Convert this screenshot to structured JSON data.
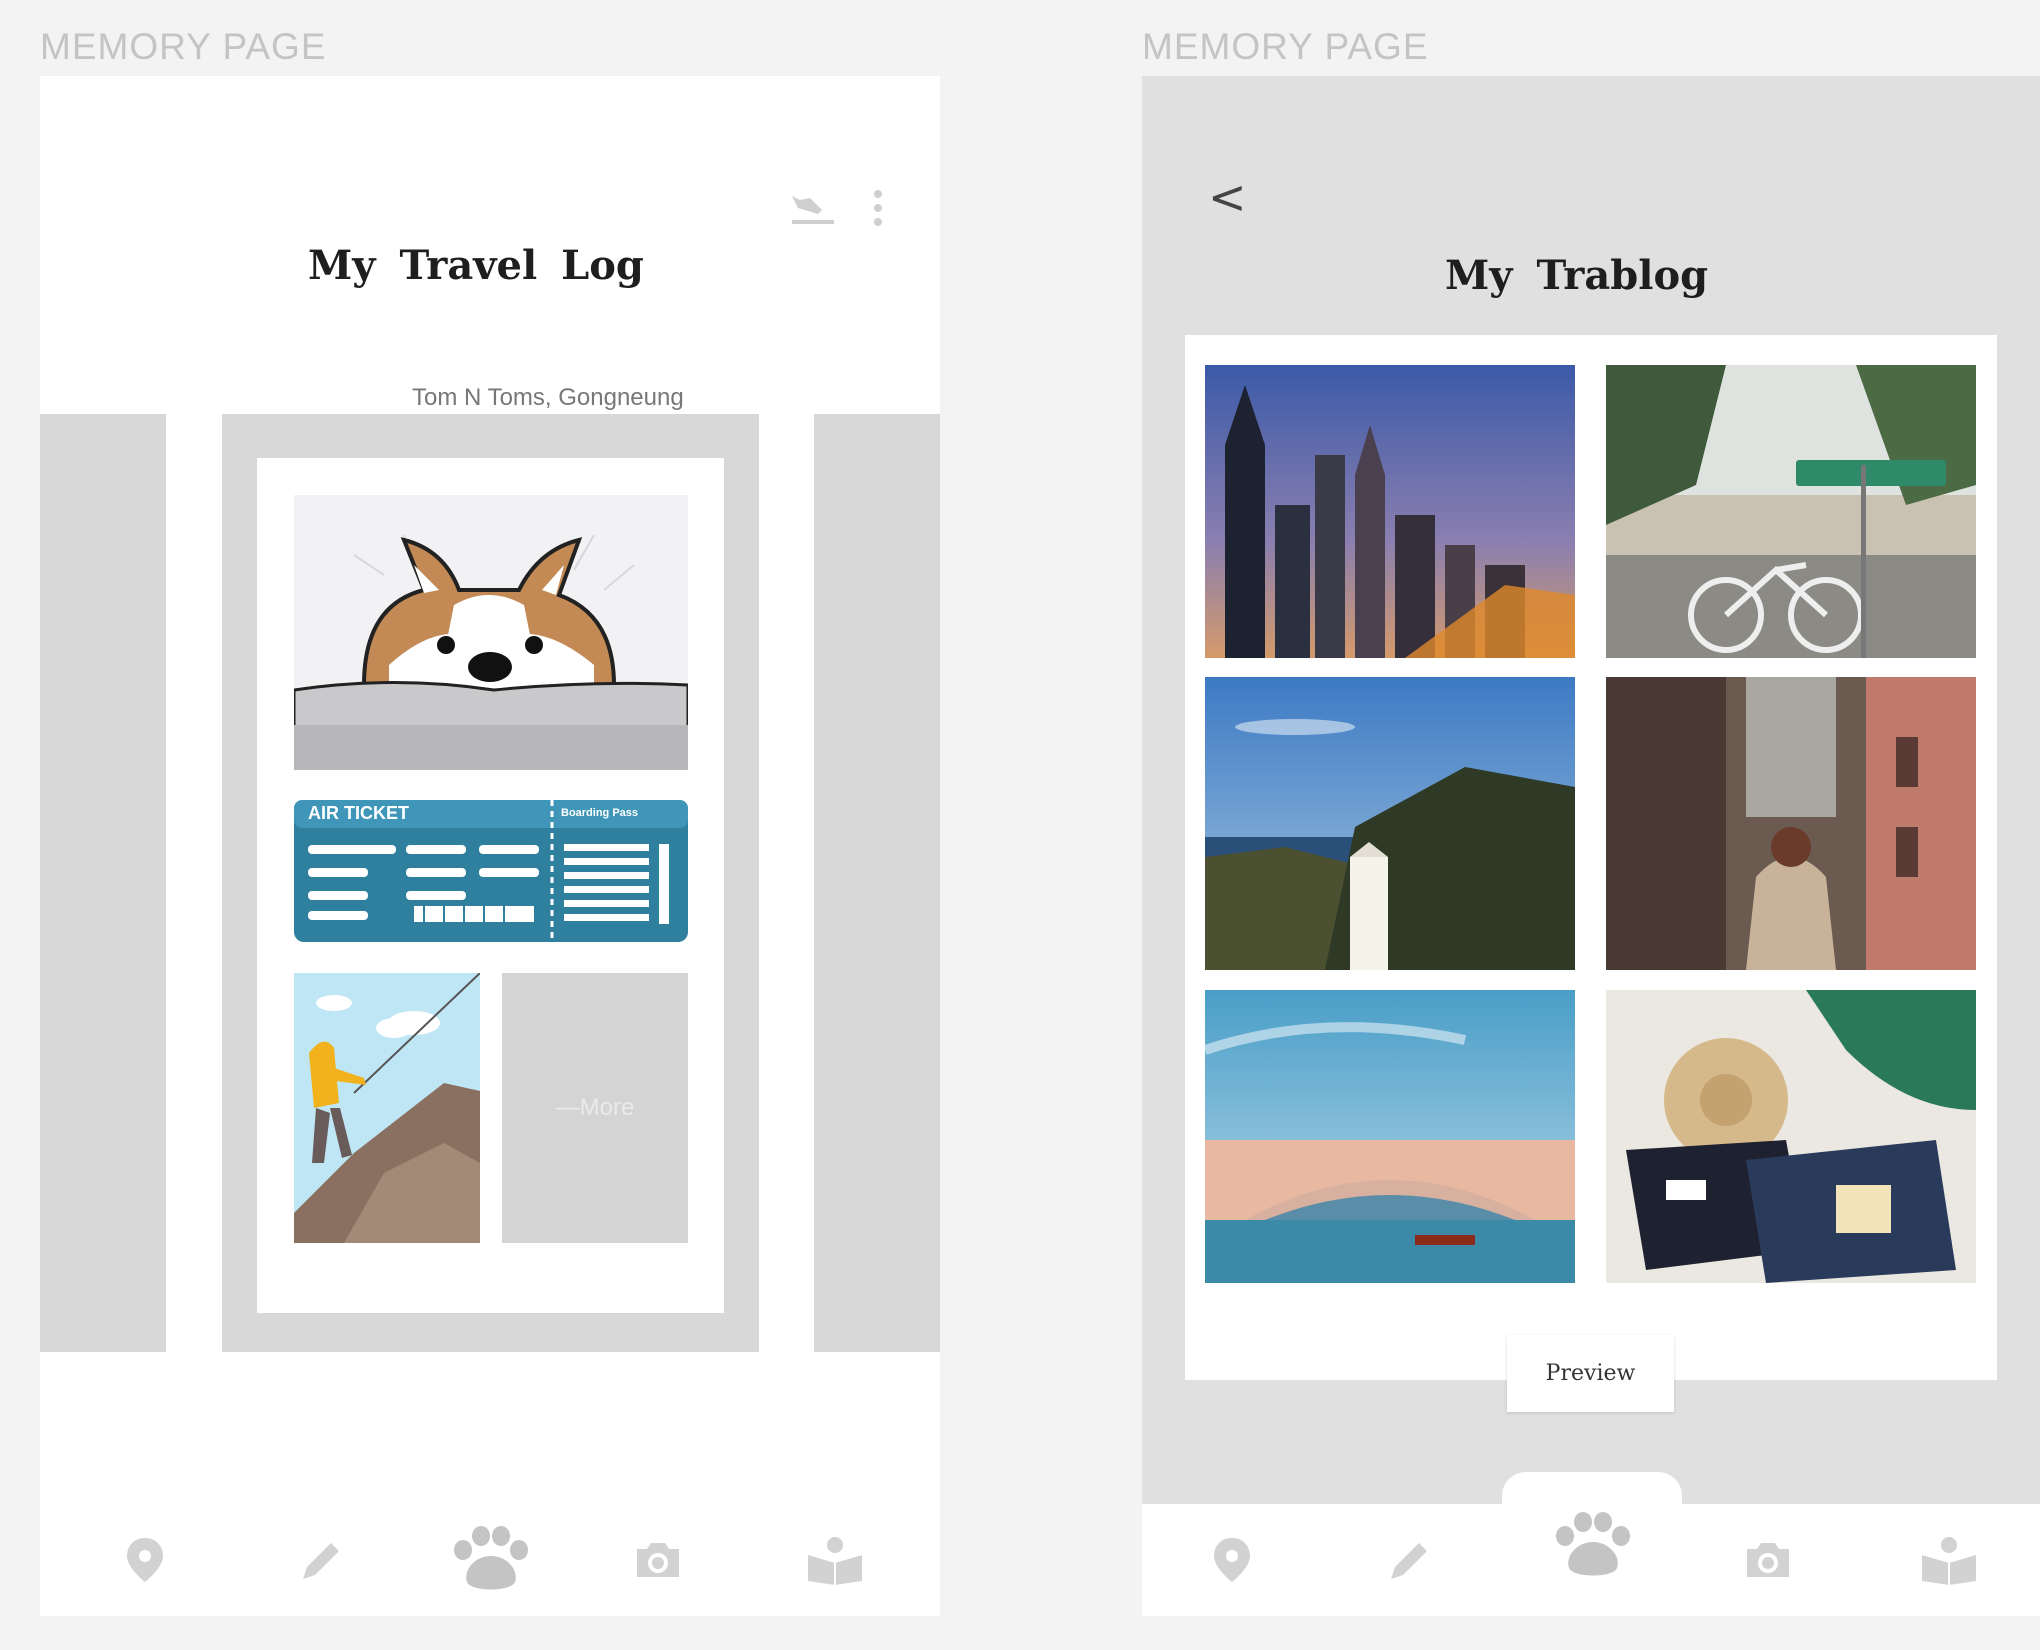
{
  "section_labels": {
    "left": "MEMORY PAGE",
    "right": "MEMORY PAGE"
  },
  "left_screen": {
    "title": "My Travel Log",
    "subtitle": "Tom N Toms, Gongneung",
    "top_icons": [
      "flight-landing-icon",
      "more-vertical-icon"
    ],
    "stickers": {
      "air_ticket": {
        "heading": "AIR TICKET",
        "stub_heading": "Boarding Pass",
        "color": "#2f7f9f"
      },
      "corgi": {
        "fur_color": "#c48a55"
      },
      "climber": {
        "jacket_color": "#f2b21d"
      },
      "more_label": "—More"
    }
  },
  "right_screen": {
    "back_label": "<",
    "title": "My Trablog",
    "photos": [
      {
        "scene": "city-skyline-dusk"
      },
      {
        "scene": "street-palms-bicycle"
      },
      {
        "scene": "milk-carton-hills-sea"
      },
      {
        "scene": "narrow-alley-backpacker"
      },
      {
        "scene": "venice-rialto-bridge"
      },
      {
        "scene": "suitcase-straw-hat"
      }
    ],
    "preview_label": "Preview"
  },
  "navbar": {
    "items": [
      {
        "icon": "location-pin-icon"
      },
      {
        "icon": "pencil-icon"
      },
      {
        "icon": "paw-icon",
        "active": true
      },
      {
        "icon": "camera-icon"
      },
      {
        "icon": "book-reader-icon"
      }
    ],
    "inactive_color": "#d2d2d2",
    "active_color": "#c4c4c4"
  }
}
